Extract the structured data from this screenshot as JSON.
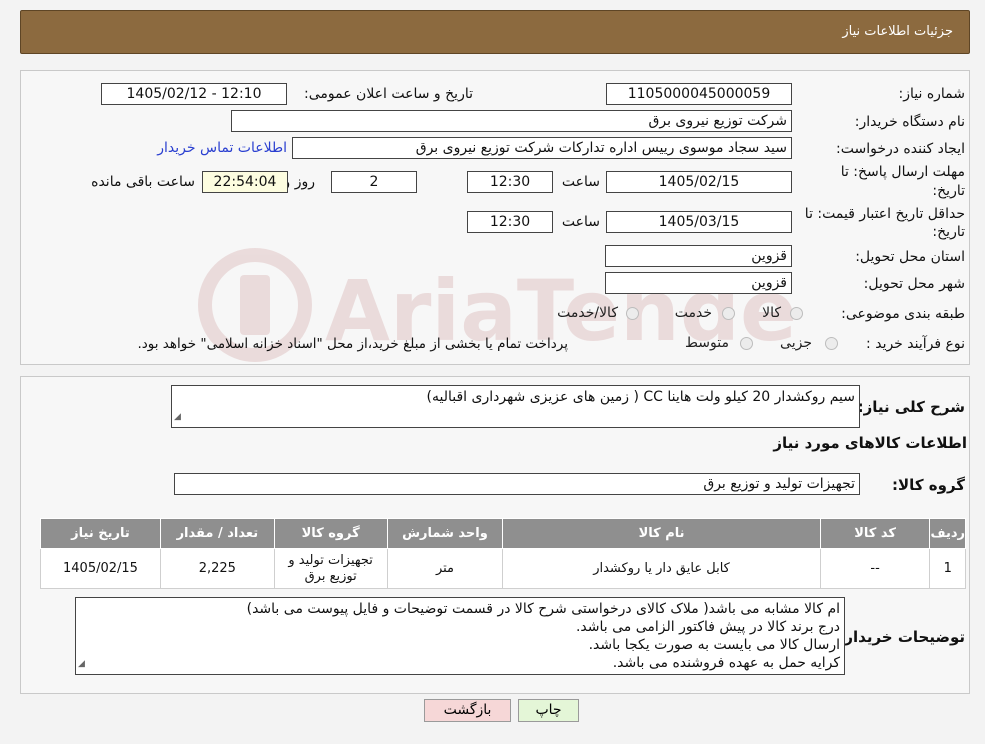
{
  "header": {
    "title": "جزئیات اطلاعات نیاز"
  },
  "need_number": {
    "label": "شماره نیاز:",
    "value": "1105000045000059"
  },
  "announce": {
    "label": "تاریخ و ساعت اعلان عمومی:",
    "value": "1405/02/12 - 12:10"
  },
  "buyer": {
    "label": "نام دستگاه خریدار:",
    "value": "شرکت توزیع نیروی برق"
  },
  "creator": {
    "label": "ایجاد کننده درخواست:",
    "value": "سید سجاد موسوی رییس اداره تدارکات شرکت توزیع نیروی برق",
    "contact_link": "اطلاعات تماس خریدار"
  },
  "deadline": {
    "label_line1": "مهلت ارسال پاسخ: تا",
    "label_line2": "تاریخ:",
    "date": "1405/02/15",
    "time_label": "ساعت",
    "time": "12:30",
    "days": "2",
    "days_label": "روز و",
    "remaining": "22:54:04",
    "remaining_label": "ساعت باقی مانده"
  },
  "validity": {
    "label_line1": "حداقل تاریخ اعتبار قیمت: تا",
    "label_line2": "تاریخ:",
    "date": "1405/03/15",
    "time_label": "ساعت",
    "time": "12:30"
  },
  "province": {
    "label": "استان محل تحویل:",
    "value": "قزوین"
  },
  "city": {
    "label": "شهر محل تحویل:",
    "value": "قزوین"
  },
  "category": {
    "label": "طبقه بندی موضوعی:",
    "options": [
      "کالا",
      "خدمت",
      "کالا/خدمت"
    ]
  },
  "process": {
    "label": "نوع فرآیند خرید :",
    "options": [
      "جزیی",
      "متوسط"
    ],
    "note": "پرداخت تمام یا بخشی از مبلغ خرید،از محل \"اسناد خزانه اسلامی\" خواهد بود."
  },
  "description": {
    "label": "شرح کلی نیاز:",
    "value": "سیم روکشدار 20 کیلو ولت هاینا CC ( زمین های عزیزی  شهرداری اقبالیه)"
  },
  "goods_section": {
    "title": "اطلاعات کالاهای مورد نیاز"
  },
  "goods_group": {
    "label": "گروه کالا:",
    "value": "تجهیزات تولید و توزیع برق"
  },
  "table": {
    "headers": [
      "ردیف",
      "کد کالا",
      "نام کالا",
      "واحد شمارش",
      "گروه کالا",
      "تعداد / مقدار",
      "تاریخ نیاز"
    ],
    "rows": [
      [
        "1",
        "--",
        "کابل عایق دار یا روکشدار",
        "متر",
        "تجهیزات تولید و توزیع برق",
        "2,225",
        "1405/02/15"
      ]
    ]
  },
  "buyer_notes": {
    "label": "توضیحات خریدار:",
    "lines": [
      "ام کالا مشابه می باشد( ملاک کالای درخواستی شرح کالا در قسمت توضیحات و فایل پیوست می باشد)",
      "درج برند کالا در پیش فاکتور الزامی می باشد.",
      "ارسال کالا می بایست به صورت یکجا باشد.",
      "کرایه حمل به عهده فروشنده می باشد."
    ]
  },
  "buttons": {
    "print": "چاپ",
    "back": "بازگشت"
  },
  "colors": {
    "header": "#8c6a3f",
    "back_button": "#f6d7d7",
    "print_button": "#e4f6d7",
    "table_header": "#8f8f8f"
  }
}
